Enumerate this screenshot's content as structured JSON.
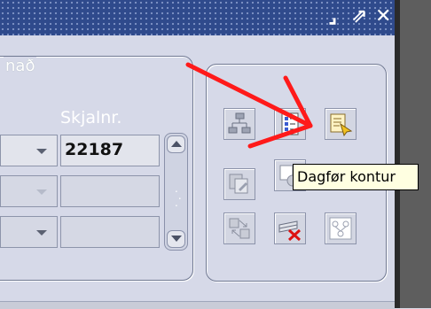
{
  "window": {
    "minimize_glyph": "⌟",
    "maximize_glyph": "⇗",
    "close_glyph": "✕"
  },
  "frame": {
    "label": "nað"
  },
  "columns": {
    "skjalnr_header": "Skjalnr."
  },
  "rows": [
    {
      "skjalnr": "22187"
    },
    {
      "skjalnr": ""
    },
    {
      "skjalnr": ""
    }
  ],
  "tooltip": {
    "text": "Dagfør kontur"
  },
  "colors": {
    "titlebar": "#2f4a8c",
    "annotation_arrow": "#ff1a1a",
    "tooltip_bg": "#ffffe1"
  }
}
